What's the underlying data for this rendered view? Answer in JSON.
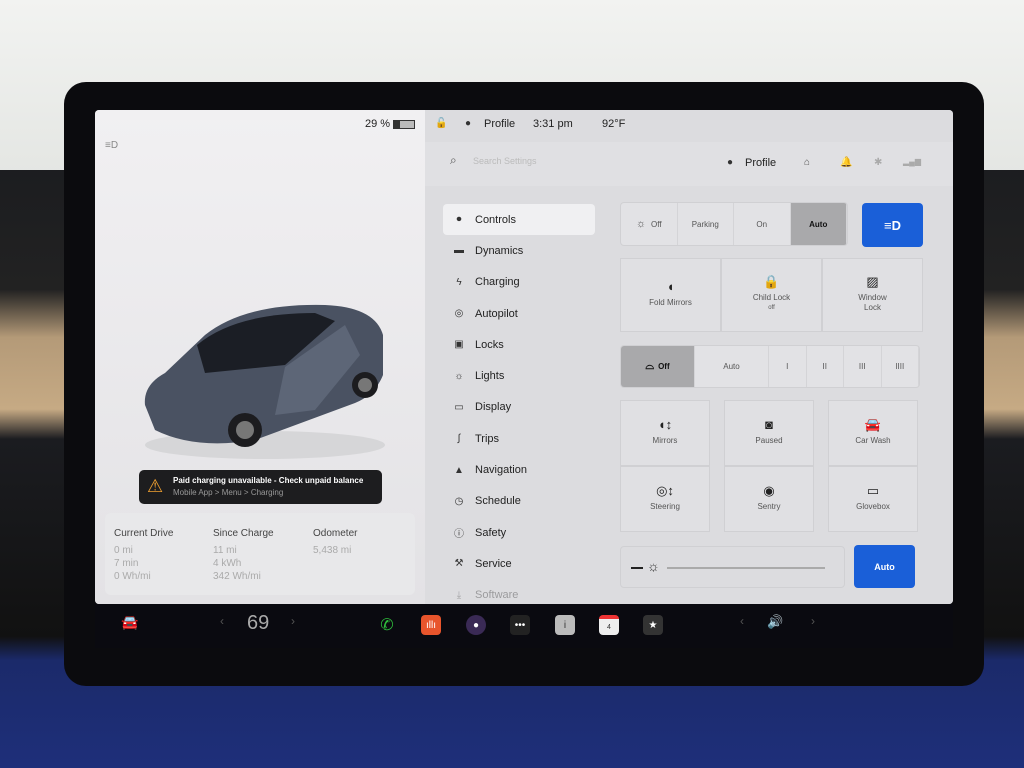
{
  "status": {
    "battery": "29 %",
    "profile": "Profile",
    "time": "3:31 pm",
    "temperature": "92°F"
  },
  "alert": {
    "title": "Paid charging unavailable - Check unpaid balance",
    "subtitle": "Mobile App > Menu > Charging",
    "color": "#f0a030"
  },
  "stats": {
    "current_drive": {
      "label": "Current Drive",
      "values": [
        "0 mi",
        "7 min",
        "0 Wh/mi"
      ]
    },
    "since_charge": {
      "label": "Since Charge",
      "values": [
        "11 mi",
        "4 kWh",
        "342 Wh/mi"
      ]
    },
    "odometer": {
      "label": "Odometer",
      "values": [
        "5,438 mi"
      ]
    }
  },
  "header": {
    "search_placeholder": "Search Settings",
    "profile": "Profile"
  },
  "menu": [
    {
      "label": "Controls",
      "icon": "toggle-icon",
      "active": true
    },
    {
      "label": "Dynamics",
      "icon": "car-icon"
    },
    {
      "label": "Charging",
      "icon": "bolt-icon"
    },
    {
      "label": "Autopilot",
      "icon": "steering-wheel-icon"
    },
    {
      "label": "Locks",
      "icon": "lock-icon"
    },
    {
      "label": "Lights",
      "icon": "sun-icon"
    },
    {
      "label": "Display",
      "icon": "display-icon"
    },
    {
      "label": "Trips",
      "icon": "trips-icon"
    },
    {
      "label": "Navigation",
      "icon": "navigation-icon"
    },
    {
      "label": "Schedule",
      "icon": "clock-icon"
    },
    {
      "label": "Safety",
      "icon": "info-icon"
    },
    {
      "label": "Service",
      "icon": "wrench-icon"
    },
    {
      "label": "Software",
      "icon": "download-icon"
    }
  ],
  "lights": {
    "options": [
      "Off",
      "Parking",
      "On",
      "Auto"
    ],
    "selected": "Auto"
  },
  "tiles1": [
    {
      "label": "Fold Mirrors",
      "sub": ""
    },
    {
      "label": "Child Lock",
      "sub": "off"
    },
    {
      "label": "Window Lock",
      "sub": ""
    }
  ],
  "wipers": {
    "options": [
      "Off",
      "Auto",
      "I",
      "II",
      "III",
      "IIII"
    ],
    "selected": "Off"
  },
  "tiles2": [
    "Mirrors",
    "Paused",
    "Car Wash",
    "Steering",
    "Sentry",
    "Glovebox"
  ],
  "brightness": {
    "auto_label": "Auto"
  },
  "taskbar": {
    "temperature": "69",
    "calendar_day": "4"
  },
  "accent": "#1a5fd8"
}
